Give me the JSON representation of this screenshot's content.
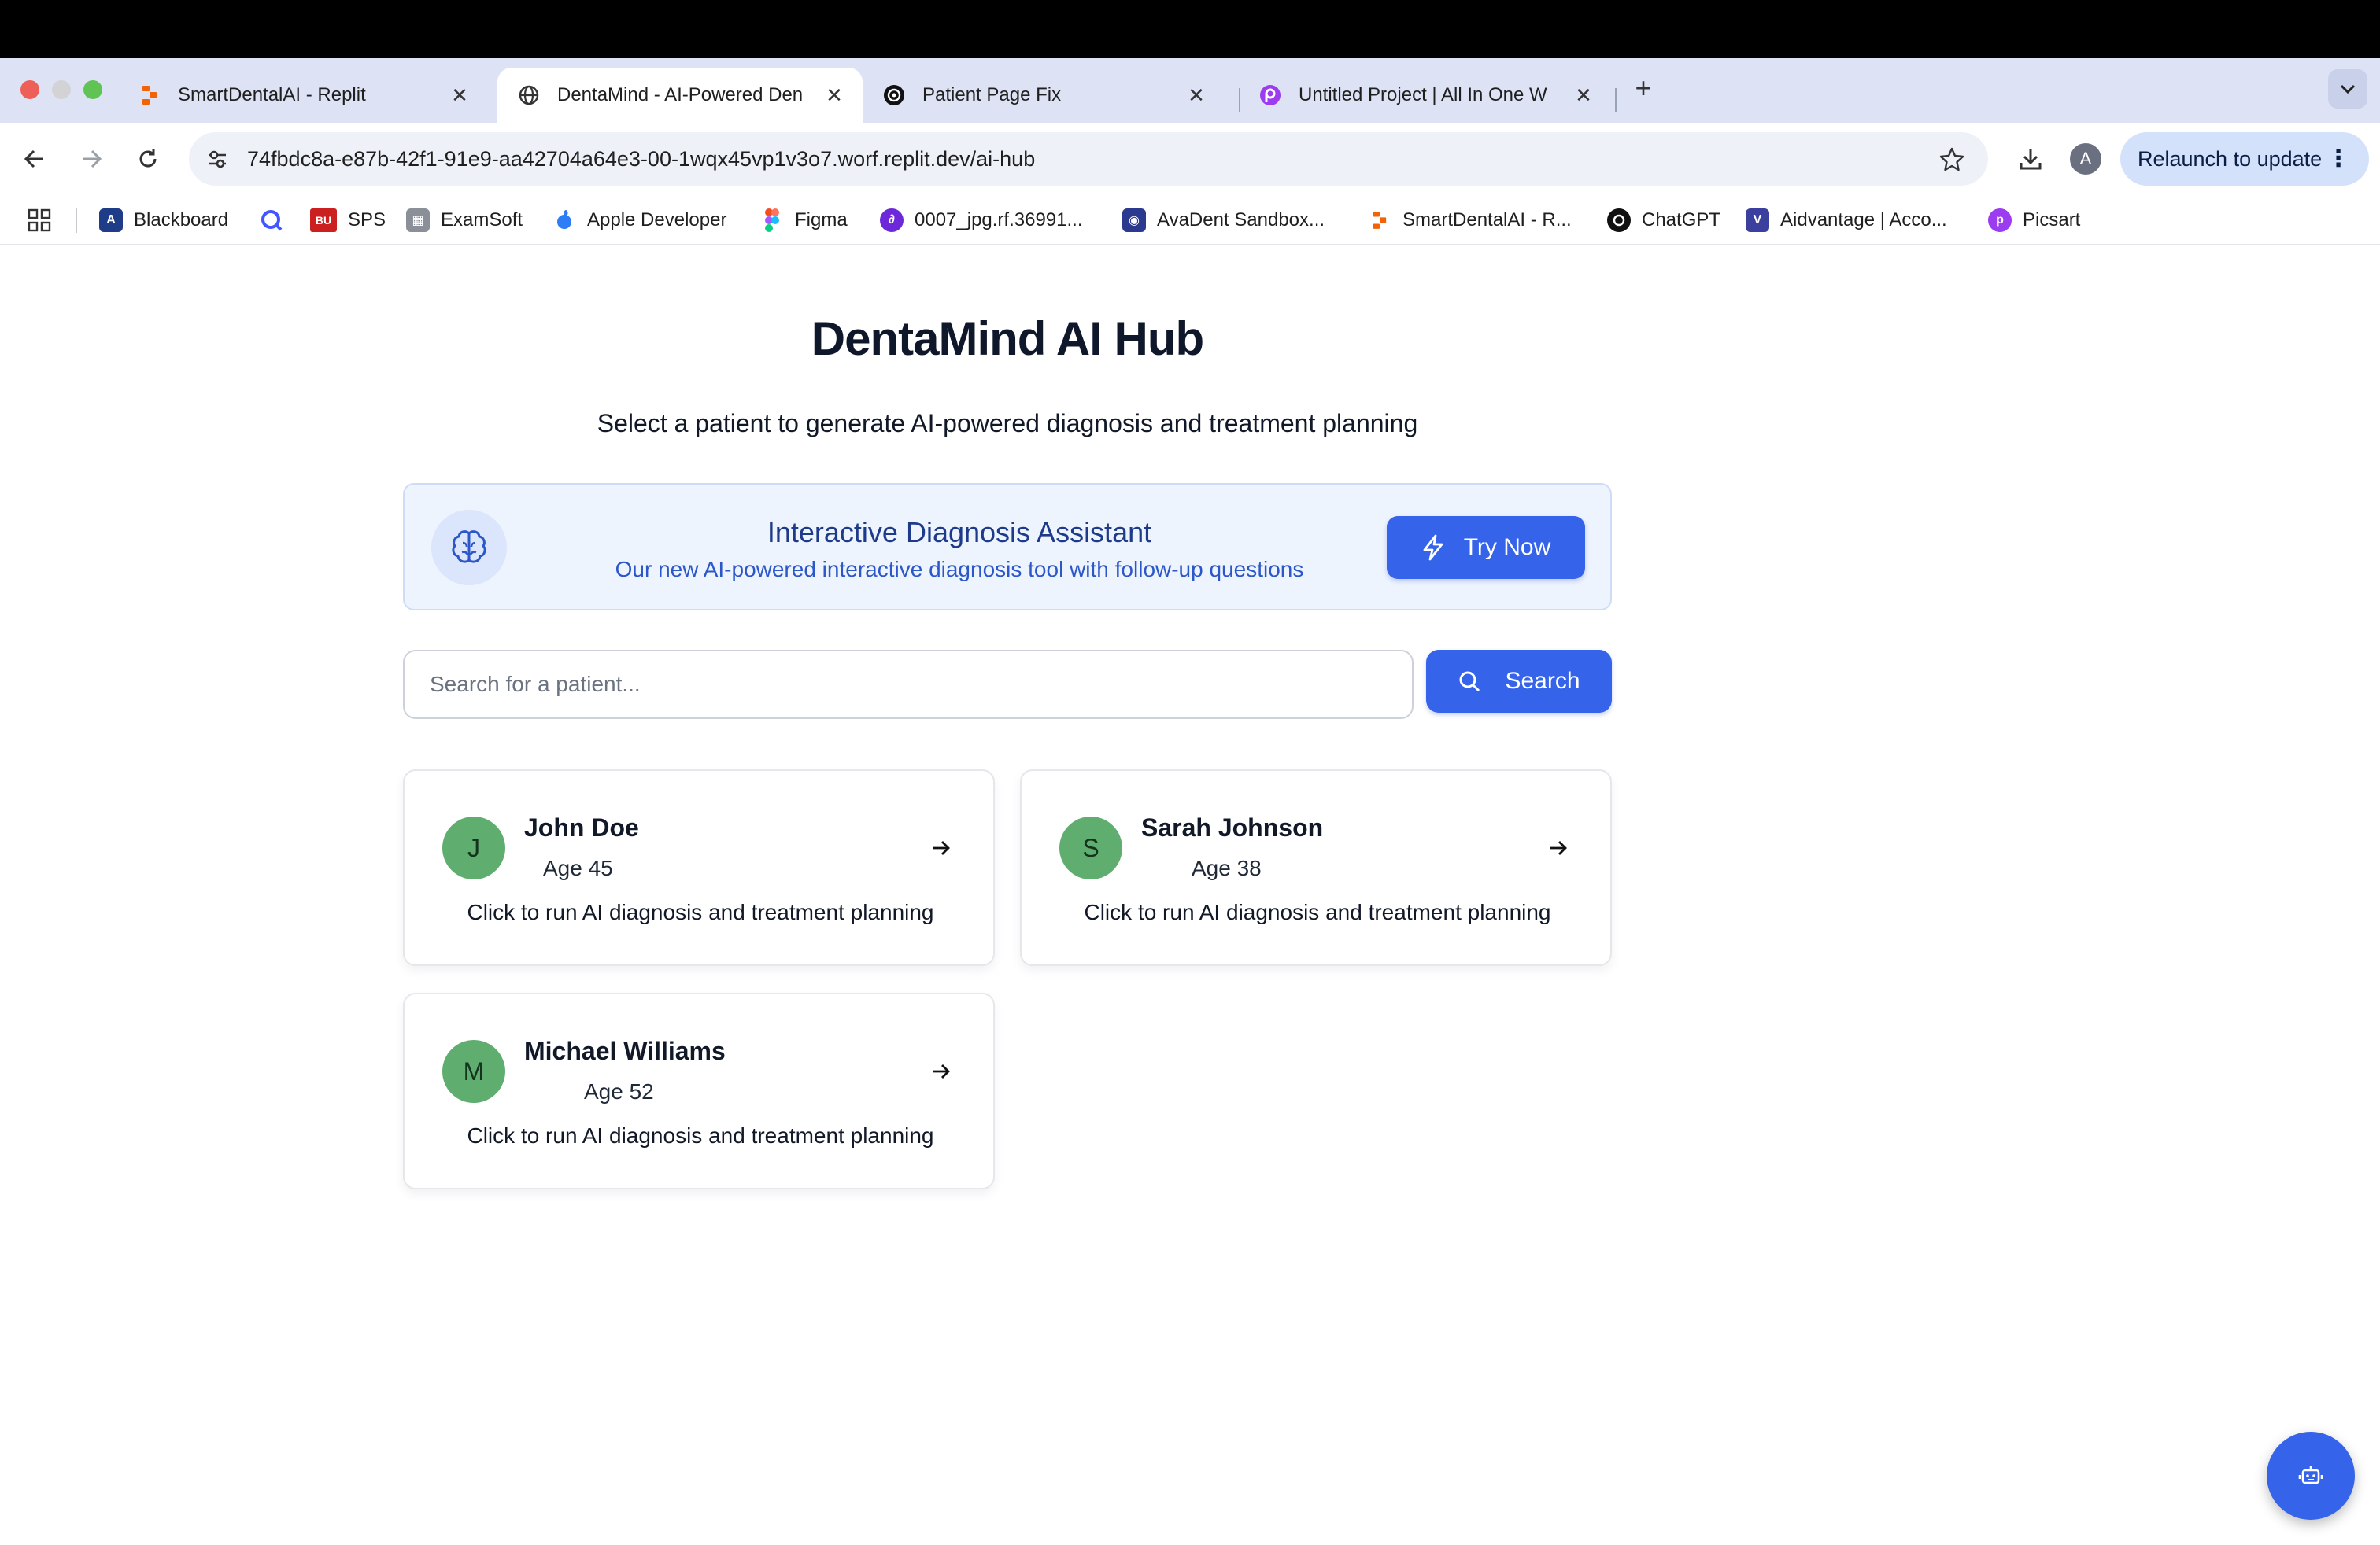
{
  "browser": {
    "tabs": [
      {
        "title": "SmartDentalAI - Replit"
      },
      {
        "title": "DentaMind - AI-Powered Den"
      },
      {
        "title": "Patient Page Fix"
      },
      {
        "title": "Untitled Project | All In One W"
      }
    ],
    "new_tab_label": "+",
    "url": "74fbdc8a-e87b-42f1-91e9-aa42704a64e3-00-1wqx45vp1v3o7.worf.replit.dev/ai-hub",
    "profile_initial": "A",
    "relaunch_label": "Relaunch to update"
  },
  "bookmarks": [
    {
      "label": "Blackboard",
      "icon": "blackboard-icon"
    },
    {
      "label": "",
      "icon": "quizlet-icon"
    },
    {
      "label": "SPS",
      "icon": "bu-icon",
      "badge": "BU"
    },
    {
      "label": "ExamSoft",
      "icon": "examsoft-icon"
    },
    {
      "label": "Apple Developer",
      "icon": "apple-icon"
    },
    {
      "label": "Figma",
      "icon": "figma-icon"
    },
    {
      "label": "0007_jpg.rf.36991...",
      "icon": "roboflow-icon"
    },
    {
      "label": "AvaDent Sandbox...",
      "icon": "avadent-icon"
    },
    {
      "label": "SmartDentalAI - R...",
      "icon": "replit-icon"
    },
    {
      "label": "ChatGPT",
      "icon": "openai-icon"
    },
    {
      "label": "Aidvantage | Acco...",
      "icon": "aidvantage-icon"
    },
    {
      "label": "Picsart",
      "icon": "picsart-icon"
    }
  ],
  "page": {
    "title": "DentaMind AI Hub",
    "subtitle": "Select a patient to generate AI-powered diagnosis and treatment planning"
  },
  "banner": {
    "title": "Interactive Diagnosis Assistant",
    "description": "Our new AI-powered interactive diagnosis tool with follow-up questions",
    "button_label": "Try Now"
  },
  "search": {
    "placeholder": "Search for a patient...",
    "value": "",
    "button_label": "Search"
  },
  "patients": [
    {
      "initial": "J",
      "name": "John Doe",
      "age": "Age 45",
      "cta": "Click to run AI diagnosis and treatment planning"
    },
    {
      "initial": "S",
      "name": "Sarah Johnson",
      "age": "Age 38",
      "cta": "Click to run AI diagnosis and treatment planning"
    },
    {
      "initial": "M",
      "name": "Michael Williams",
      "age": "Age 52",
      "cta": "Click to run AI diagnosis and treatment planning"
    }
  ],
  "colors": {
    "primary": "#3563e9",
    "banner_bg": "#eef4fe",
    "avatar": "#5fae6f",
    "tabstrip": "#dde3f5"
  }
}
